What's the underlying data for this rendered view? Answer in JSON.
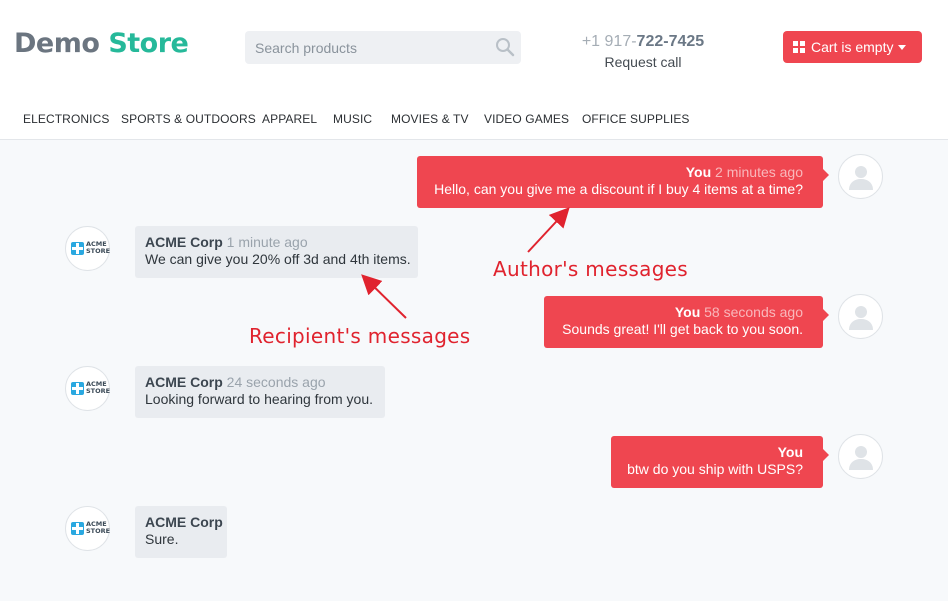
{
  "header": {
    "logo_word1": "Demo",
    "logo_word2": "Store",
    "search_placeholder": "Search products",
    "phone_prefix": "+1 917-",
    "phone_main": "722-7425",
    "request_call": "Request call",
    "cart_label": "Cart is empty"
  },
  "nav": {
    "items": [
      {
        "label": "ELECTRONICS"
      },
      {
        "label": "SPORTS & OUTDOORS"
      },
      {
        "label": "APPAREL"
      },
      {
        "label": "MUSIC"
      },
      {
        "label": "MOVIES & TV"
      },
      {
        "label": "VIDEO GAMES"
      },
      {
        "label": "OFFICE SUPPLIES"
      }
    ]
  },
  "messages": [
    {
      "sender": "You",
      "time": "2 minutes ago",
      "text": "Hello, can you give me a discount if I buy 4 items at a time?"
    },
    {
      "sender": "ACME Corp",
      "time": "1 minute ago",
      "text": "We can give you 20% off 3d and 4th items."
    },
    {
      "sender": "You",
      "time": "58 seconds ago",
      "text": "Sounds great! I'll get back to you soon."
    },
    {
      "sender": "ACME Corp",
      "time": "24 seconds ago",
      "text": "Looking forward to hearing from you."
    },
    {
      "sender": "You",
      "time": "",
      "text": "btw do you ship with USPS?"
    },
    {
      "sender": "ACME Corp",
      "time": "",
      "text": "Sure."
    }
  ],
  "acme_logo": {
    "line1": "ACME",
    "line2": "STORE"
  },
  "annotations": {
    "author": "Author's messages",
    "recipient": "Recipient's messages"
  },
  "colors": {
    "accent": "#ef4650",
    "brand_green": "#26b99a",
    "annotation": "#e0232e"
  },
  "icons": {
    "search": "search-icon",
    "cart": "grid-icon",
    "user": "user-avatar-icon"
  }
}
